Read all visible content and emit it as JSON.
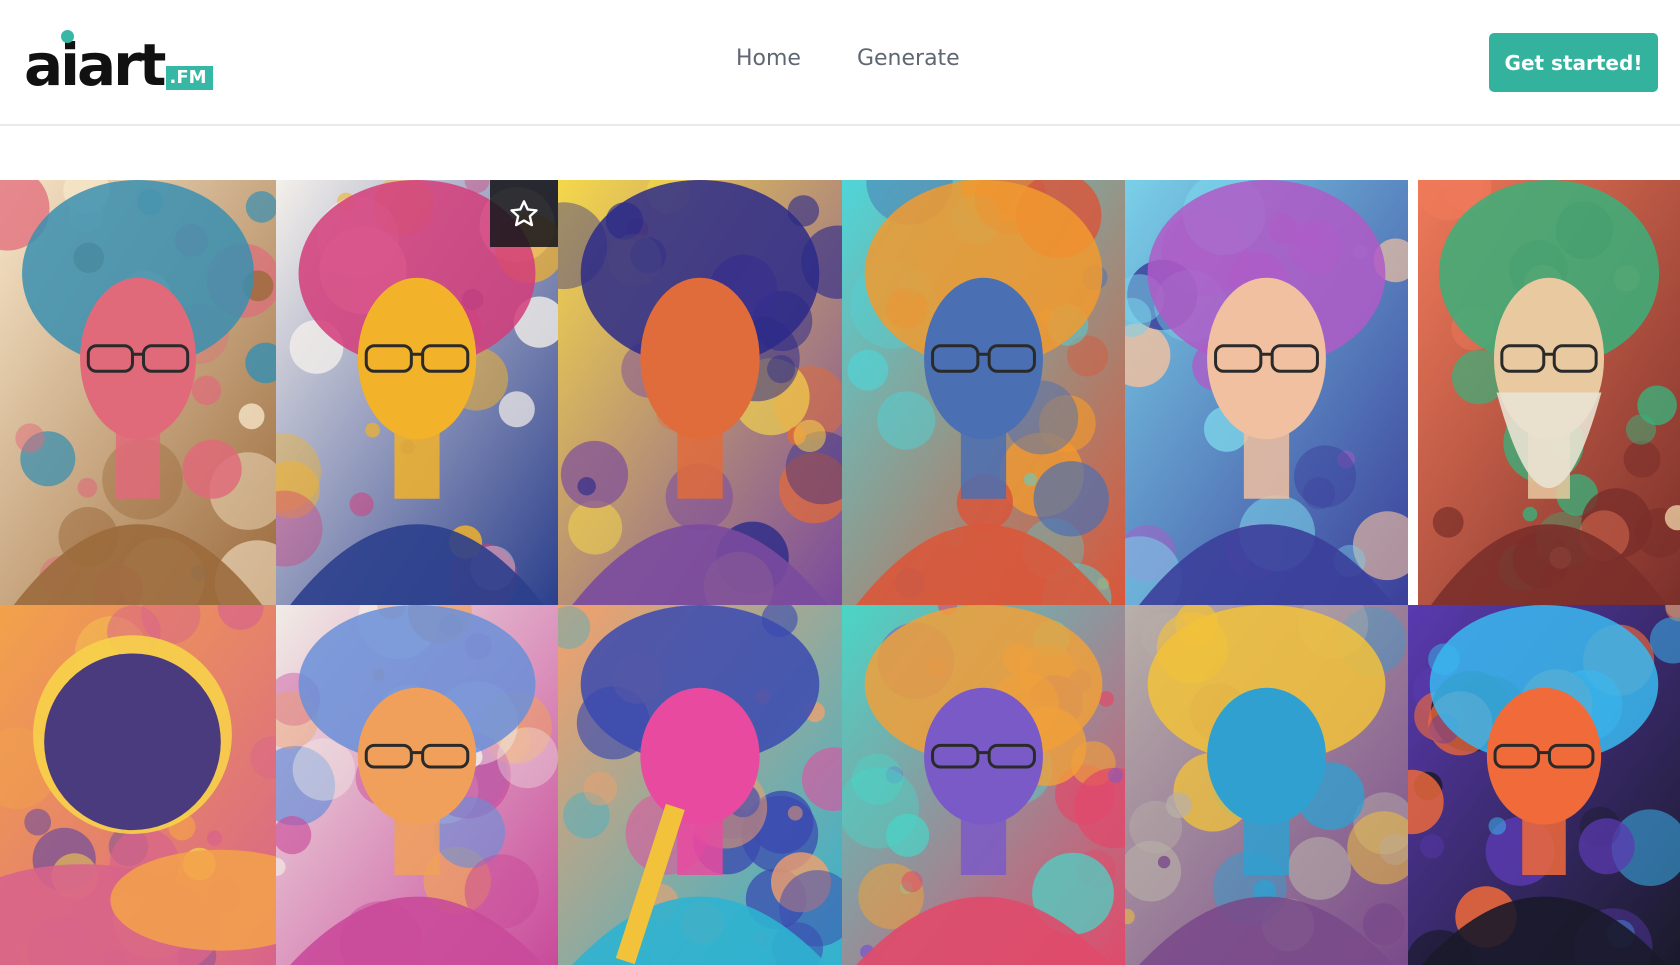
{
  "brand": {
    "name": "aiart",
    "suffix": ".FM",
    "accent": "#37b7a5"
  },
  "nav": {
    "items": [
      {
        "label": "Home"
      },
      {
        "label": "Generate"
      }
    ]
  },
  "cta": {
    "label": "Get started!",
    "color": "#33b29d"
  },
  "gallery": {
    "favorite_icon": "star-outline-icon",
    "items": [
      {
        "name": "portrait-man-glasses-curly-hair",
        "palette": [
          "#f6e5c8",
          "#3a8fb0",
          "#e06a7a",
          "#9b6a3c"
        ]
      },
      {
        "name": "portrait-man-gold-glasses",
        "palette": [
          "#f4f0ea",
          "#d43c7a",
          "#f2b22a",
          "#2b3f8c"
        ]
      },
      {
        "name": "portrait-man-afro",
        "palette": [
          "#f5d84a",
          "#2b2a8a",
          "#e06b3b",
          "#7a4a9e"
        ]
      },
      {
        "name": "portrait-man-orange-hair",
        "palette": [
          "#4ed6d9",
          "#f29a2e",
          "#4a6fb3",
          "#d9563a"
        ]
      },
      {
        "name": "portrait-man-white-hair",
        "palette": [
          "#7ad0e8",
          "#b05ac7",
          "#f0c0a0",
          "#3b3f9a"
        ]
      },
      {
        "name": "portrait-old-man-beard",
        "palette": [
          "#ef7a5a",
          "#3ab07a",
          "#e9c9a0",
          "#7b2f2a"
        ]
      },
      {
        "name": "eclipse-planet-clouds",
        "palette": [
          "#f3a24a",
          "#6a4a9e",
          "#f7d24a",
          "#d8648a"
        ]
      },
      {
        "name": "portrait-floral-head",
        "palette": [
          "#f1ece6",
          "#6a8fd8",
          "#f0a05a",
          "#c94a9a"
        ]
      },
      {
        "name": "guitarist-blue-skin",
        "palette": [
          "#f6a06a",
          "#3a4ab0",
          "#e84aa0",
          "#2fb3d0"
        ]
      },
      {
        "name": "portrait-flower-head-profile",
        "palette": [
          "#49d6c7",
          "#f0a03a",
          "#7a5ac7",
          "#e04a6a"
        ]
      },
      {
        "name": "portrait-hooded-figure",
        "palette": [
          "#b9b0a8",
          "#f2c23a",
          "#2fa0d0",
          "#7a4a8a"
        ]
      },
      {
        "name": "portrait-man-blue-fire-hair",
        "palette": [
          "#5a3ab0",
          "#3ab8f0",
          "#f06a3a",
          "#1a1a2a"
        ]
      }
    ]
  }
}
